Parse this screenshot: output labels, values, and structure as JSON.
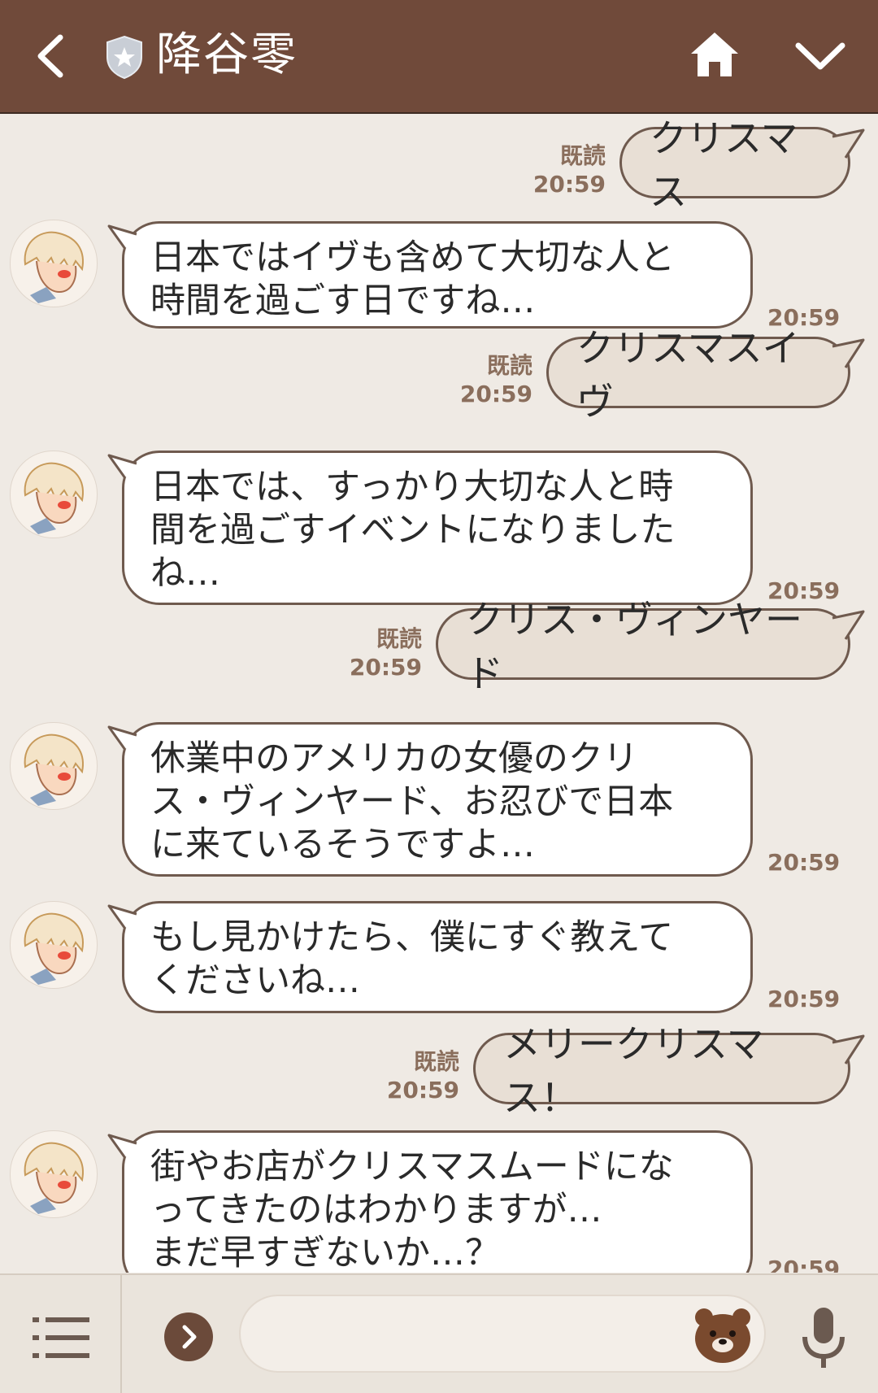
{
  "header": {
    "title": "降谷零",
    "icons": {
      "back": "chevron-left-icon",
      "badge": "shield-star-icon",
      "home": "home-icon",
      "menu": "chevron-down-icon"
    }
  },
  "messages": [
    {
      "dir": "out",
      "text": "クリスマス",
      "read": "既読",
      "time": "20:59"
    },
    {
      "dir": "in",
      "text": "日本ではイヴも含めて大切な人と\n時間を過ごす日ですね…",
      "time": "20:59"
    },
    {
      "dir": "out",
      "text": "クリスマスイヴ",
      "read": "既読",
      "time": "20:59"
    },
    {
      "dir": "in",
      "text": "日本では、すっかり大切な人と時\n間を過ごすイベントになりました\nね…",
      "time": "20:59"
    },
    {
      "dir": "out",
      "text": "クリス・ヴィンヤード",
      "read": "既読",
      "time": "20:59"
    },
    {
      "dir": "in",
      "text": "休業中のアメリカの女優のクリ\nス・ヴィンヤード、お忍びで日本\nに来ているそうですよ…",
      "time": "20:59"
    },
    {
      "dir": "in",
      "text": "もし見かけたら、僕にすぐ教えて\nくださいね…",
      "time": "20:59"
    },
    {
      "dir": "out",
      "text": "メリークリスマス！",
      "read": "既読",
      "time": "20:59"
    },
    {
      "dir": "in",
      "text": "街やお店がクリスマスムードにな\nってきたのはわかりますが…\nまだ早すぎないか…？",
      "time": "20:59"
    }
  ],
  "bottom_bar": {
    "input_placeholder": "",
    "icons": {
      "menu": "menu-icon",
      "expand": "chevron-right-circle-icon",
      "sticker": "bear-face-icon",
      "voice": "microphone-icon"
    }
  },
  "colors": {
    "header": "#704a3a",
    "background": "#efeae4",
    "outgoing_bubble": "#e8dfd5",
    "incoming_bubble": "#ffffff",
    "meta_text": "#8a6e5c"
  }
}
